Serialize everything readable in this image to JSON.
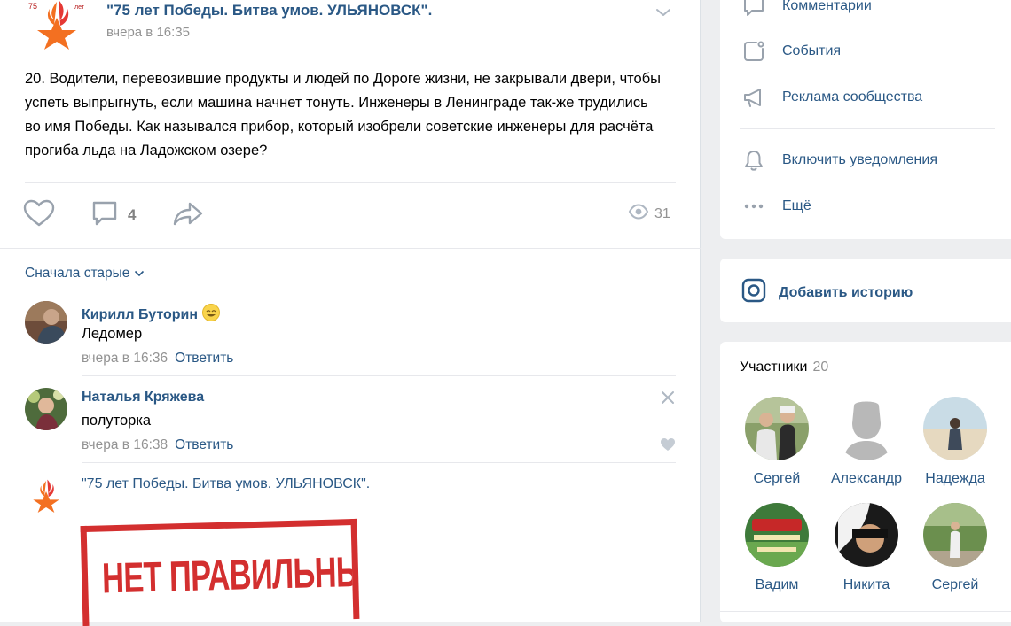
{
  "post": {
    "group_name": "\"75 лет Победы. Битва умов. УЛЬЯНОВСК\".",
    "time": "вчера в 16:35",
    "logo_text_left": "75",
    "logo_text_right": "лет",
    "text": "20. Водители, перевозившие продукты и людей по Дороге жизни, не закрывали двери, чтобы успеть выпрыгнуть, если машина начнет тонуть. Инженеры в Ленинграде так-же трудились во имя Победы. Как назывался прибор, который изобрели советские инженеры для расчёта прогиба льда на Ладожском озере?",
    "comment_count": "4",
    "views_count": "31"
  },
  "comments": {
    "sort_label": "Сначала старые",
    "reply_label": "Ответить",
    "items": [
      {
        "author": "Кирилл Буторин",
        "text": "Ледомер",
        "time": "вчера в 16:36"
      },
      {
        "author": "Наталья Кряжева",
        "text": "полуторка",
        "time": "вчера в 16:38"
      }
    ],
    "group_reply": {
      "author": "\"75 лет Победы. Битва умов. УЛЬЯНОВСК\".",
      "stamp_text": "НЕТ ПРАВИЛЬНЫХ"
    }
  },
  "sidebar": {
    "menu": [
      {
        "label": "Комментарии",
        "icon": "comments-icon"
      },
      {
        "label": "События",
        "icon": "events-icon"
      },
      {
        "label": "Реклама сообщества",
        "icon": "megaphone-icon"
      },
      {
        "label": "Включить уведомления",
        "icon": "bell-icon"
      },
      {
        "label": "Ещё",
        "icon": "more-icon"
      }
    ],
    "add_story": "Добавить историю",
    "members": {
      "title": "Участники",
      "count": "20",
      "list": [
        {
          "name": "Сергей"
        },
        {
          "name": "Александр"
        },
        {
          "name": "Надежда"
        },
        {
          "name": "Вадим"
        },
        {
          "name": "Никита"
        },
        {
          "name": "Сергей"
        }
      ]
    }
  },
  "colors": {
    "link": "#2a5885",
    "muted": "#939393",
    "icon": "#99a2ad",
    "stamp": "#d32f2f",
    "logo_orange": "#f37021"
  }
}
